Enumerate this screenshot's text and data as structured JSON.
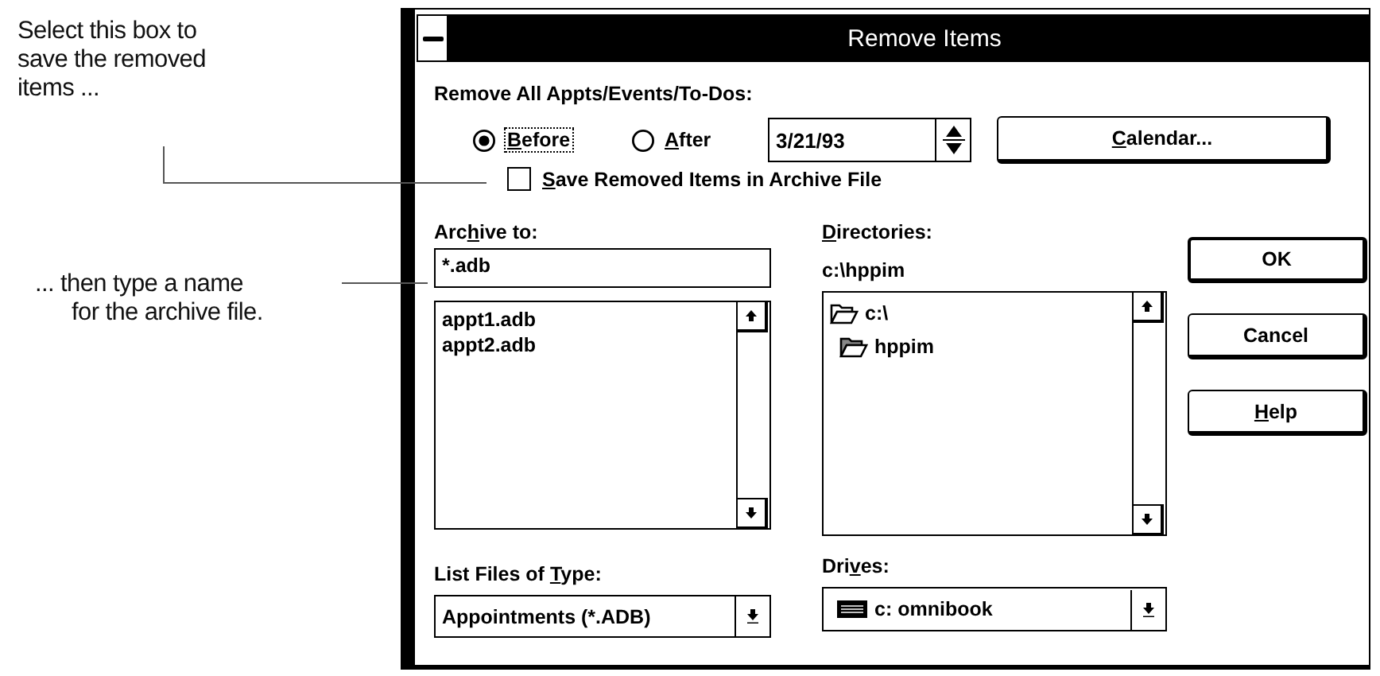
{
  "annotations": [
    {
      "lines": [
        "Select this box to",
        "save the removed",
        "items ..."
      ]
    },
    {
      "lines": [
        "... then type a name",
        "for the archive file."
      ]
    }
  ],
  "window": {
    "title": "Remove Items"
  },
  "remove_label": "Remove All Appts/Events/To-Dos:",
  "range_options": [
    {
      "label": {
        "key": "B",
        "post": "efore"
      },
      "selected": true,
      "focused": true
    },
    {
      "label": {
        "key": "A",
        "post": "fter"
      },
      "selected": false,
      "focused": false
    }
  ],
  "date_field": {
    "value": "3/21/93"
  },
  "calendar_button": {
    "label": {
      "key": "C",
      "post": "alendar..."
    }
  },
  "save_checkbox": {
    "label": {
      "key": "S",
      "post": "ave Removed Items in Archive File"
    },
    "checked": false
  },
  "archive": {
    "label": {
      "pre": "Arc",
      "key": "h",
      "post": "ive to:"
    },
    "value": "*.adb",
    "files": [
      "appt1.adb",
      "appt2.adb"
    ]
  },
  "file_type": {
    "label": {
      "pre": "List Files of ",
      "key": "T",
      "post": "ype:"
    },
    "value": "Appointments (*.ADB)"
  },
  "directories": {
    "label": {
      "key": "D",
      "post": "irectories:"
    },
    "path": "c:\\hppim",
    "tree": [
      {
        "name": "c:\\",
        "children": [
          {
            "name": "hppim",
            "current": true
          }
        ]
      }
    ]
  },
  "drives": {
    "label": {
      "pre": "Dri",
      "key": "v",
      "post": "es:"
    },
    "value": "c: omnibook"
  },
  "buttons": [
    {
      "label": {
        "post": "OK"
      },
      "default": true
    },
    {
      "label": {
        "post": "Cancel"
      },
      "default": false
    },
    {
      "label": {
        "key": "H",
        "post": "elp"
      },
      "default": false
    }
  ]
}
